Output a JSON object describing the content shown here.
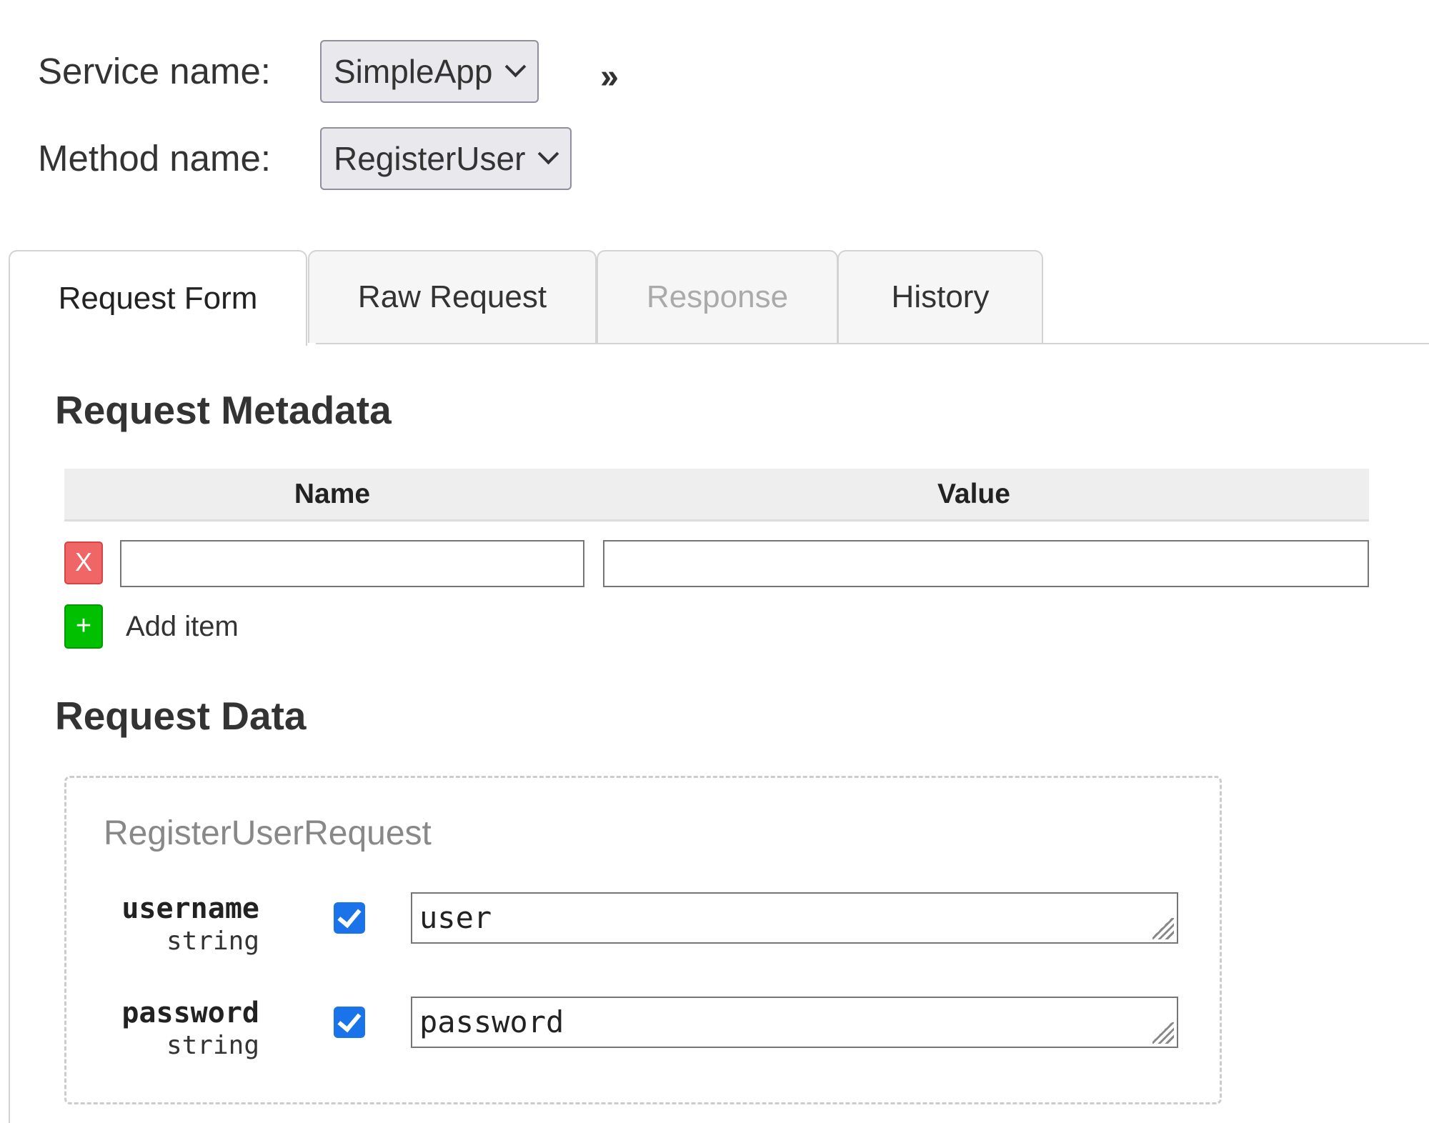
{
  "selectors": {
    "service_label": "Service name:",
    "service_value": "SimpleApp",
    "method_label": "Method name:",
    "method_value": "RegisterUser",
    "expand_glyph": "››"
  },
  "tabs": [
    {
      "label": "Request Form",
      "state": "active"
    },
    {
      "label": "Raw Request",
      "state": "normal"
    },
    {
      "label": "Response",
      "state": "disabled"
    },
    {
      "label": "History",
      "state": "normal"
    }
  ],
  "metadata": {
    "title": "Request Metadata",
    "columns": {
      "name": "Name",
      "value": "Value"
    },
    "rows": [
      {
        "remove_label": "X",
        "name": "",
        "value": ""
      }
    ],
    "add_button": "+",
    "add_label": "Add item"
  },
  "request_data": {
    "title": "Request Data",
    "message_type": "RegisterUserRequest",
    "fields": [
      {
        "name": "username",
        "type": "string",
        "checked": true,
        "value": "user"
      },
      {
        "name": "password",
        "type": "string",
        "checked": true,
        "value": "password"
      }
    ]
  },
  "colors": {
    "remove_button": "#f06666",
    "add_button": "#00c000",
    "checkbox": "#1a73e8",
    "disabled_tab_text": "#aaaaaa"
  }
}
